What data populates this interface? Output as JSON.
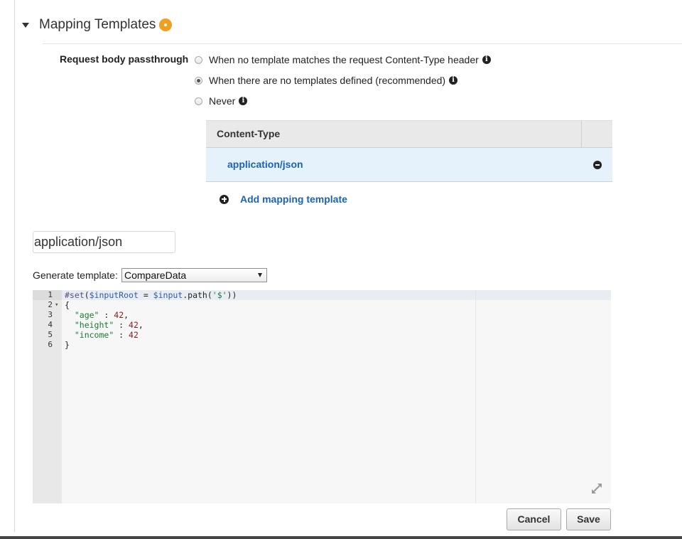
{
  "section": {
    "title": "Mapping Templates"
  },
  "passthrough": {
    "label": "Request body passthrough",
    "options": [
      {
        "label": "When no template matches the request Content-Type header",
        "selected": false,
        "has_info": true
      },
      {
        "label": "When there are no templates defined (recommended)",
        "selected": true,
        "has_info": true
      },
      {
        "label": "Never",
        "selected": false,
        "has_info": true
      }
    ]
  },
  "content_type_table": {
    "header": "Content-Type",
    "rows": [
      "application/json"
    ]
  },
  "add_template": {
    "label": "Add mapping template"
  },
  "content_type_input": {
    "value": "application/json"
  },
  "generate_template": {
    "label": "Generate template:",
    "selected": "CompareData"
  },
  "editor": {
    "line_numbers": [
      "1",
      "2",
      "3",
      "4",
      "5",
      "6"
    ],
    "lines": [
      "#set($inputRoot = $input.path('$'))",
      "{",
      "  \"age\" : 42,",
      "  \"height\" : 42,",
      "  \"income\" : 42",
      "}"
    ]
  },
  "buttons": {
    "cancel": "Cancel",
    "save": "Save"
  },
  "colors": {
    "accent_link": "#1b63b1",
    "status_dot": "#f0a020",
    "selected_row": "#e5f1fb"
  },
  "icons": [
    "caret-down-icon",
    "status-dot-icon",
    "info-icon",
    "minus-circle-icon",
    "plus-circle-icon",
    "fold-arrow-icon",
    "expand-icon",
    "select-arrow-icon"
  ]
}
